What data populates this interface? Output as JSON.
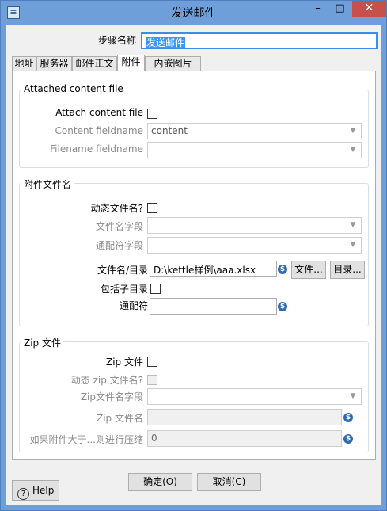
{
  "window": {
    "title": "发送邮件",
    "app_icon": "pentaho-icon",
    "minimize_glyph": "–",
    "maximize_glyph": "□",
    "close_glyph": "✕"
  },
  "step_name": {
    "label": "步骤名称",
    "value": "发送邮件"
  },
  "tabs": [
    {
      "label": "地址"
    },
    {
      "label": "服务器"
    },
    {
      "label": "邮件正文"
    },
    {
      "label": "附件"
    },
    {
      "label": "内嵌图片"
    }
  ],
  "attached_content": {
    "title": "Attached content file",
    "attach_label": "Attach content file",
    "content_fieldname_label": "Content fieldname",
    "content_fieldname_value": "content",
    "filename_fieldname_label": "Filename fieldname",
    "filename_fieldname_value": ""
  },
  "attachment_filename": {
    "title": "附件文件名",
    "dynamic_label": "动态文件名?",
    "filename_field_label": "文件名字段",
    "wildcard_field_label": "通配符字段",
    "file_dir_label": "文件名/目录",
    "file_dir_value": "D:\\kettle样例\\aaa.xlsx",
    "file_button": "文件...",
    "dir_button": "目录...",
    "include_subdir_label": "包括子目录",
    "wildcard_label": "通配符",
    "wildcard_value": ""
  },
  "zip": {
    "title": "Zip 文件",
    "zip_label": "Zip 文件",
    "dynamic_zip_label": "动态 zip 文件名?",
    "zip_field_label": "Zip文件名字段",
    "zip_name_label": "Zip 文件名",
    "zip_name_value": "",
    "compress_label": "如果附件大于...则进行压缩",
    "compress_value": "0"
  },
  "footer": {
    "ok": "确定(O)",
    "cancel": "取消(C)",
    "help": "Help"
  },
  "colors": {
    "title_bar": "#6f9fd8",
    "close_button": "#c7504b",
    "selection": "#3399ff",
    "variable_icon": "#2f6bb5"
  },
  "icons": {
    "variable": "$",
    "help": "?",
    "dropdown": "▼"
  }
}
